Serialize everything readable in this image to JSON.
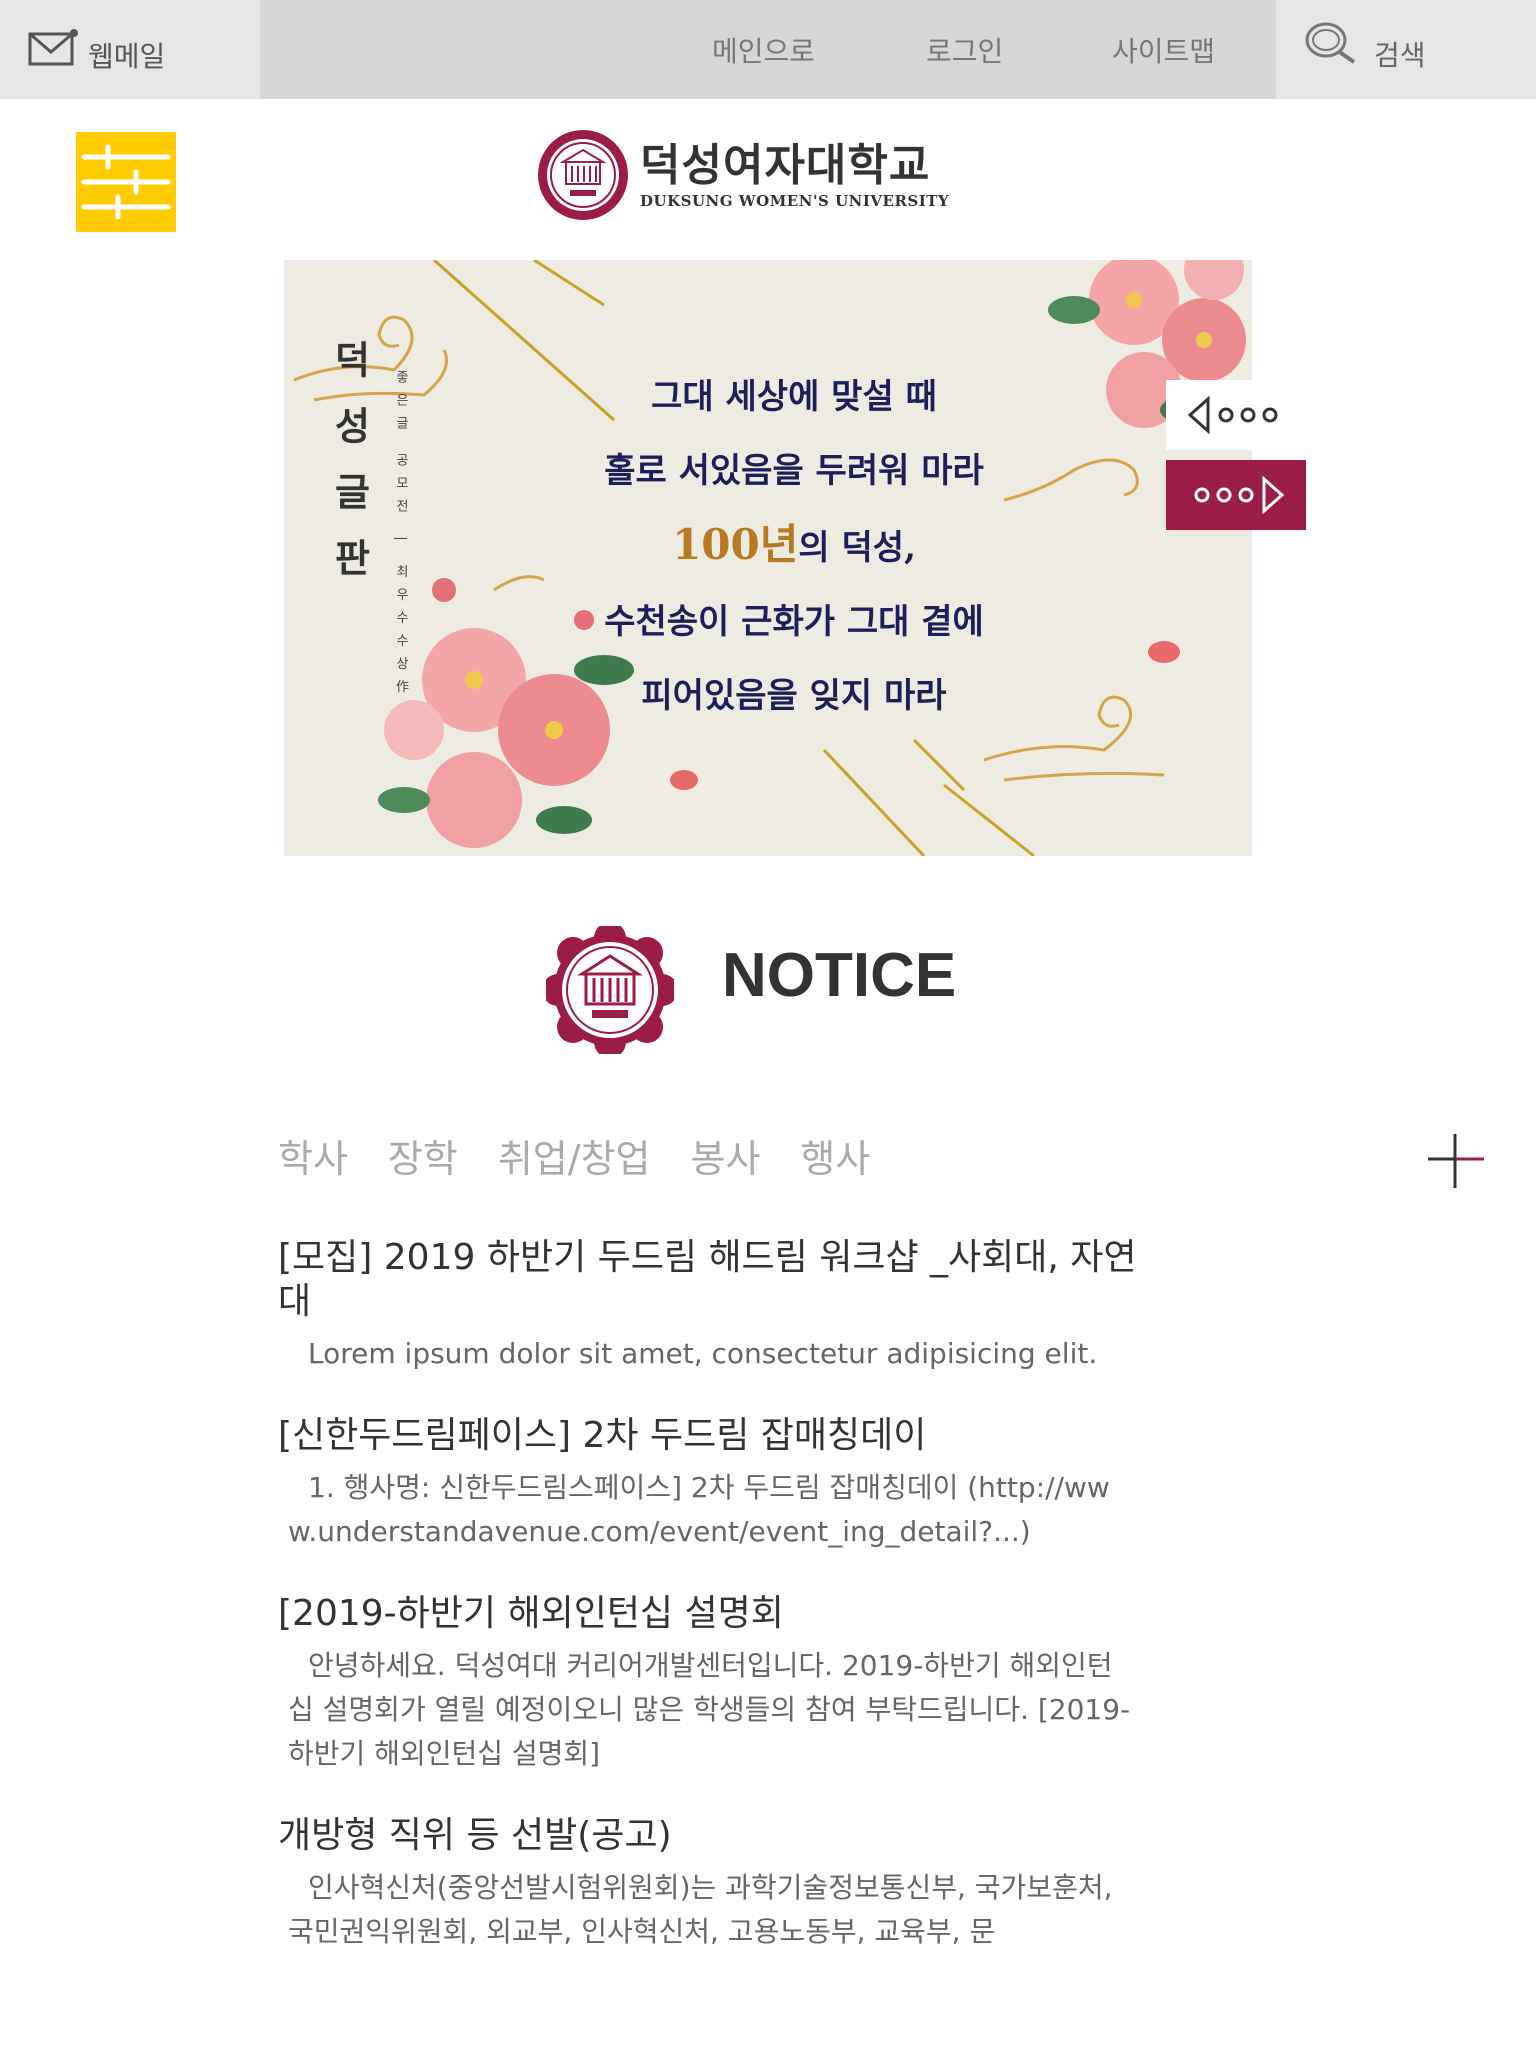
{
  "topbar": {
    "webmail_label": "웹메일",
    "nav": [
      "메인으로",
      "로그인",
      "사이트맵"
    ],
    "search_label": "검색"
  },
  "header": {
    "logo_korean": "덕성여자대학교",
    "logo_english": "DUKSUNG WOMEN'S UNIVERSITY"
  },
  "banner": {
    "vertical_title": "덕성글판",
    "vertical_subtitle": "좋은글 공모전 | 최우수수상作",
    "poem": [
      "그대 세상에 맞설 때",
      "홀로 서있음을 두려워 마라",
      "100년의 덕성,",
      "수천송이 근화가 그대 곁에",
      "피어있음을 잊지 마라"
    ],
    "poem_highlight": "100년"
  },
  "notice": {
    "title": "NOTICE",
    "tabs": [
      "학사",
      "장학",
      "취업/창업",
      "봉사",
      "행사"
    ],
    "items": [
      {
        "title": "[모집] 2019 하반기 두드림 해드림 워크샵 _사회대, 자연대",
        "desc": "Lorem ipsum dolor sit amet, consectetur adipisicing elit."
      },
      {
        "title": "[신한두드림페이스] 2차 두드림 잡매칭데이",
        "desc": "1. 행사명: 신한두드림스페이스] 2차 두드림 잡매칭데이 (http://www.understandavenue.com/event/event_ing_detail?...)"
      },
      {
        "title": "[2019-하반기 해외인턴십 설명회",
        "desc": "안녕하세요. 덕성여대 커리어개발센터입니다. 2019-하반기 해외인턴십 설명회가 열릴 예정이오니 많은 학생들의 참여 부탁드립니다. [2019-하반기 해외인턴십 설명회]"
      },
      {
        "title": "개방형 직위 등 선발(공고)",
        "desc": "인사혁신처(중앙선발시험위원회)는 과학기술정보통신부, 국가보훈처, 국민권익위원회, 외교부, 인사혁신처, 고용노동부, 교육부, 문"
      }
    ]
  },
  "colors": {
    "accent_yellow": "#ffcc00",
    "brand_maroon": "#9b1c48",
    "topbar_gray": "#e6e6e6"
  },
  "icons": [
    "mail-icon",
    "search-icon",
    "menu-sliders-icon",
    "prev-arrow-icon",
    "next-arrow-icon",
    "plus-icon",
    "university-emblem"
  ]
}
